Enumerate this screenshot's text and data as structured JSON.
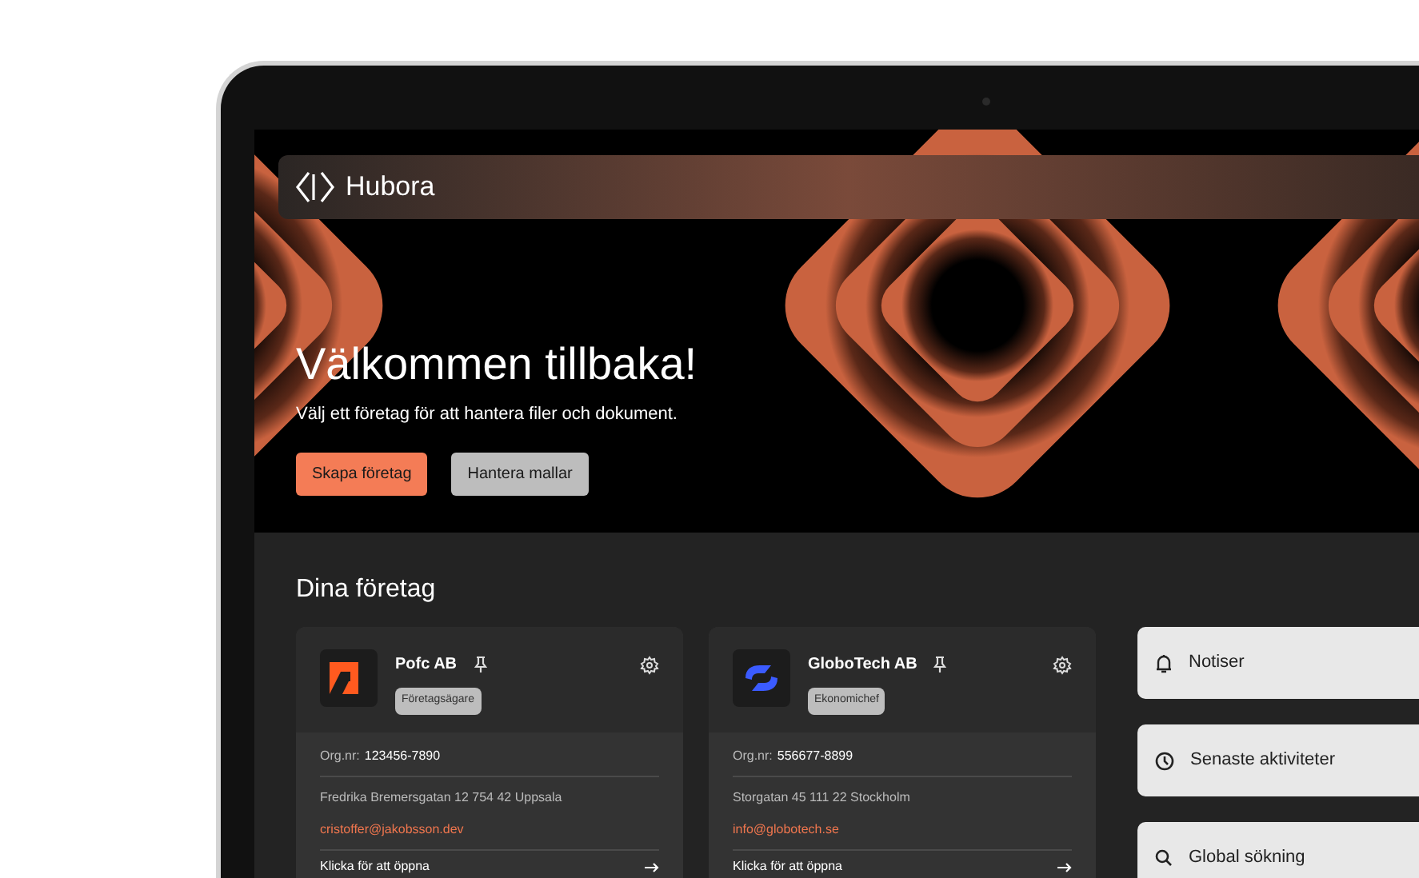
{
  "brand": {
    "name": "Hubora"
  },
  "hero": {
    "title": "Välkommen tillbaka!",
    "subtitle": "Välj ett företag för att hantera filer och dokument.",
    "buttons": [
      {
        "label": "Skapa företag",
        "kind": "primary"
      },
      {
        "label": "Hantera mallar",
        "kind": "secondary"
      }
    ]
  },
  "companies_section": {
    "title": "Dina företag",
    "companies": [
      {
        "name": "Pofc AB",
        "kind": "orange-mark",
        "role": "Företagsägare",
        "org_label": "Org.nr:",
        "org_number": "123456-7890",
        "address": "Fredrika Bremersgatan 12 754 42 Uppsala",
        "email": "cristoffer@jakobsson.dev",
        "action": "Klicka för att öppna"
      },
      {
        "name": "GloboTech AB",
        "kind": "blue-mark",
        "role": "Ekonomichef",
        "org_label": "Org.nr:",
        "org_number": "556677-8899",
        "address": "Storgatan 45 111 22 Stockholm",
        "email": "info@globotech.se",
        "action": "Klicka för att öppna"
      }
    ]
  },
  "side_panels": [
    {
      "label": "Notiser",
      "kind": "bell"
    },
    {
      "label": "Senaste aktiviteter",
      "kind": "clock"
    },
    {
      "label": "Global sökning",
      "kind": "search"
    }
  ]
}
